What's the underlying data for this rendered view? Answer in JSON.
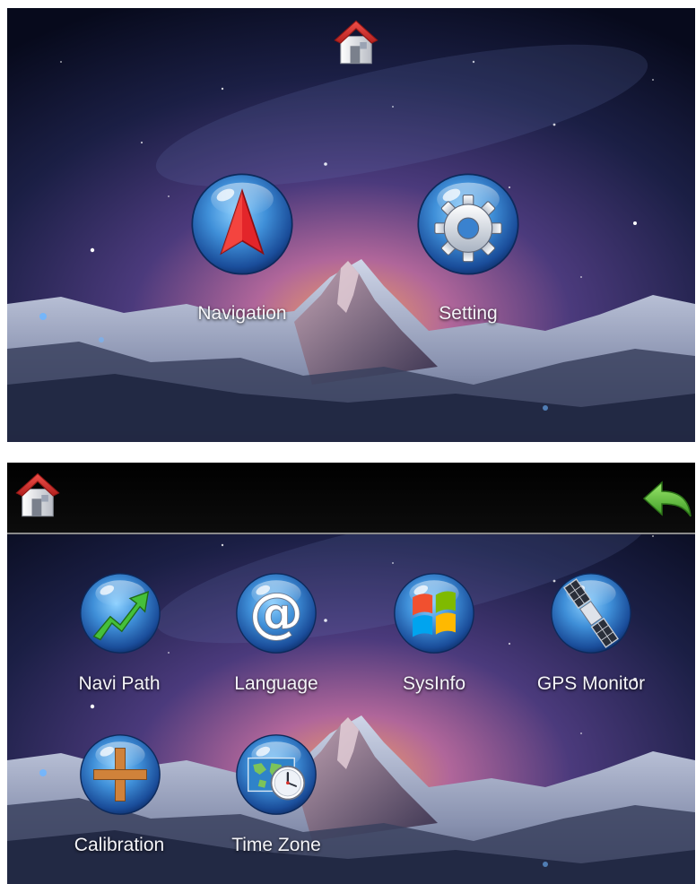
{
  "main_menu": {
    "navigation_label": "Navigation",
    "setting_label": "Setting"
  },
  "settings_menu": {
    "items": [
      {
        "label": "Navi Path",
        "icon": "trend-arrow-icon"
      },
      {
        "label": "Language",
        "icon": "at-sign-icon"
      },
      {
        "label": "SysInfo",
        "icon": "windows-logo-icon"
      },
      {
        "label": "GPS Monitor",
        "icon": "satellite-icon"
      },
      {
        "label": "Calibration",
        "icon": "crosshair-plus-icon"
      },
      {
        "label": "Time Zone",
        "icon": "world-clock-icon"
      }
    ],
    "language_glyph": "@"
  },
  "colors": {
    "bubble_blue": "#3f8fd8",
    "home_roof_red": "#d8322e",
    "back_arrow_green": "#5cc33a",
    "nav_arrow_red": "#e3252a",
    "navi_path_green": "#45c03a",
    "calibration_orange": "#d0823a"
  }
}
